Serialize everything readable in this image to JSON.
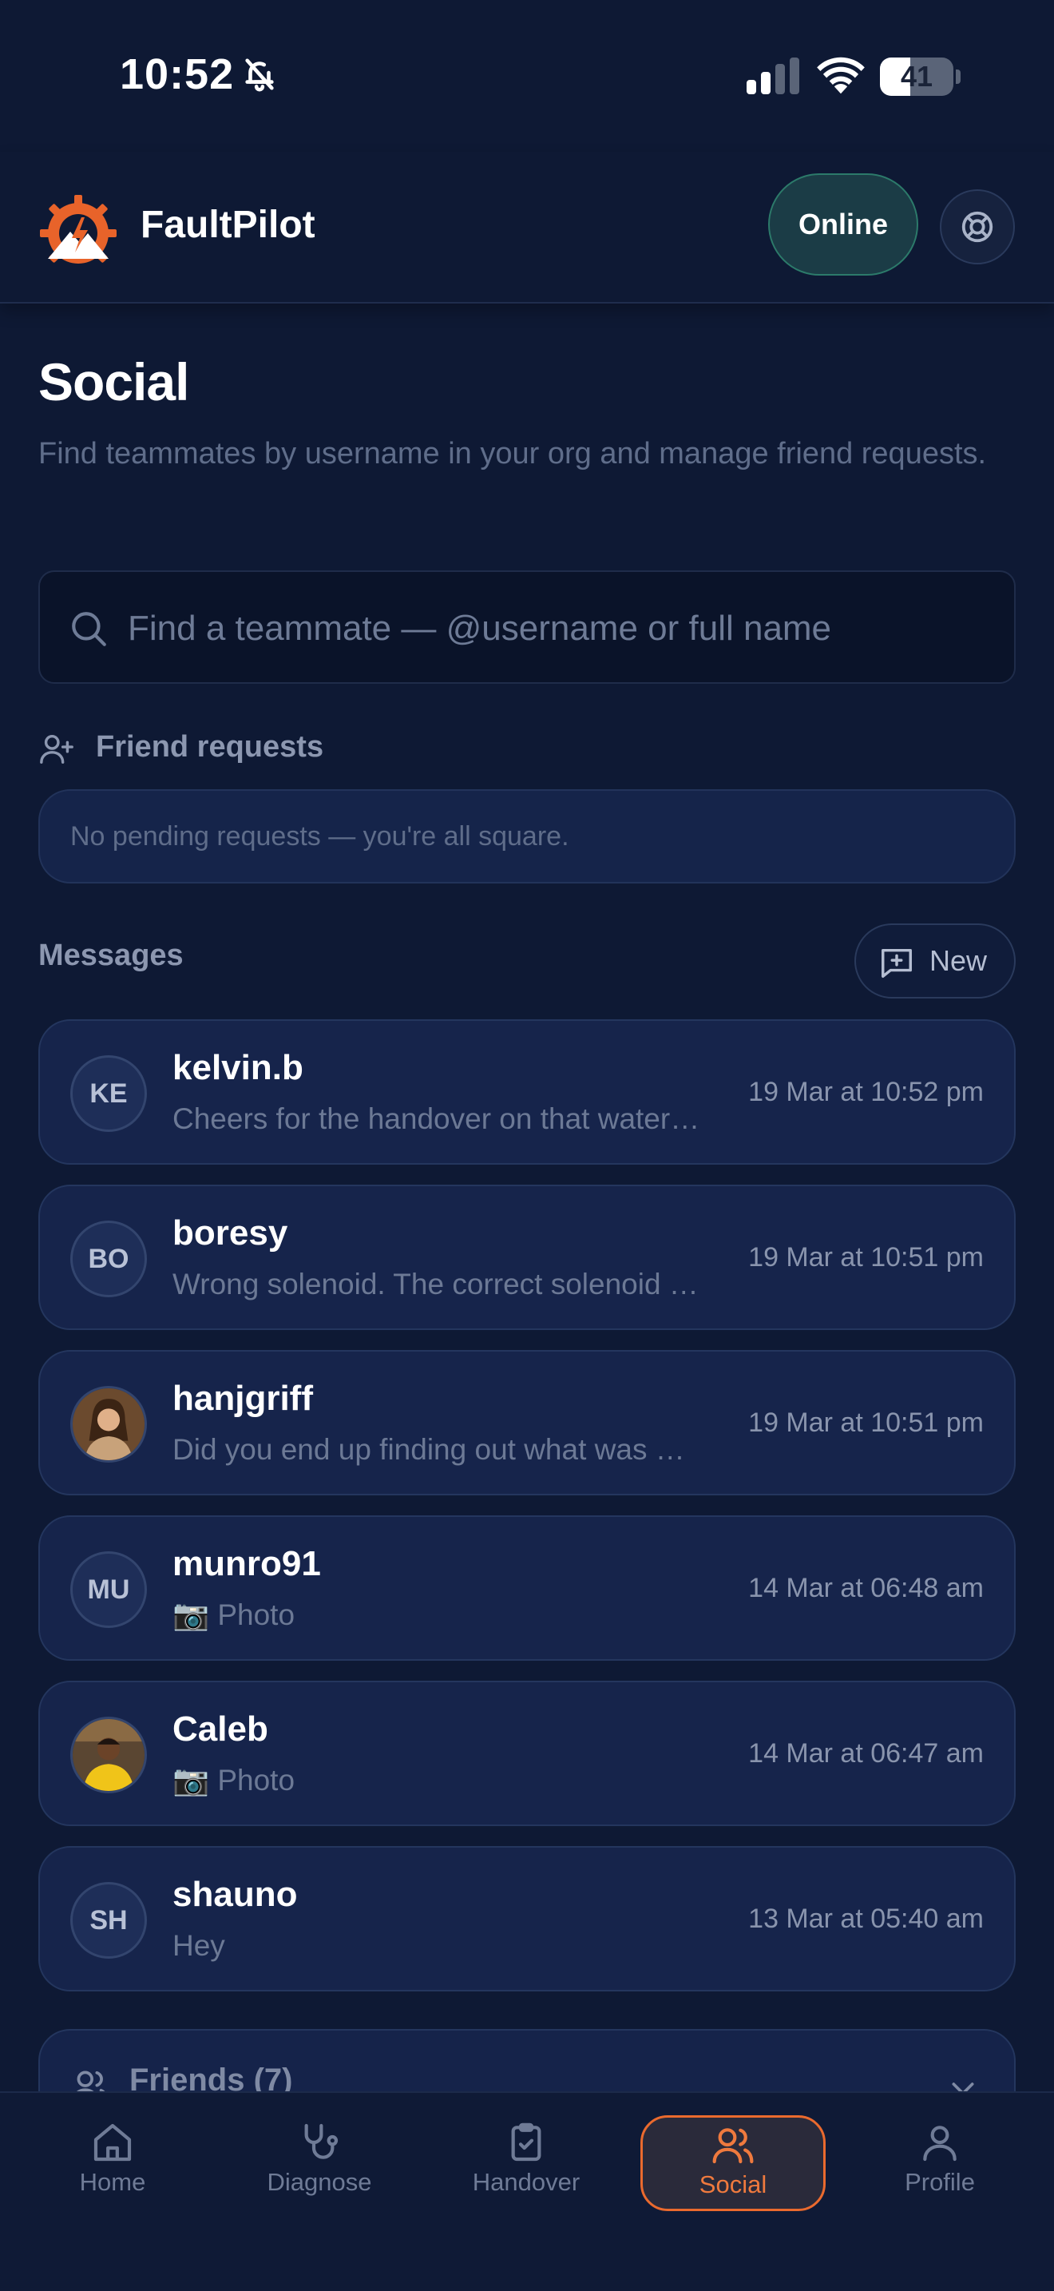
{
  "status_bar": {
    "time": "10:52",
    "battery": "41",
    "battery_level": 0.41
  },
  "header": {
    "app_name": "FaultPilot",
    "status_label": "Online"
  },
  "page": {
    "title": "Social",
    "subtitle": "Find teammates by username in your org and manage friend requests."
  },
  "search": {
    "placeholder": "Find a teammate — @username or full name"
  },
  "friend_requests": {
    "heading": "Friend requests",
    "empty_text": "No pending requests — you're all square."
  },
  "messages": {
    "heading": "Messages",
    "new_label": "New",
    "items": [
      {
        "initials": "KE",
        "name": "kelvin.b",
        "preview": "Cheers for the handover on that water…",
        "time": "19 Mar at 10:52 pm",
        "avatar": "initials"
      },
      {
        "initials": "BO",
        "name": "boresy",
        "preview": "Wrong solenoid. The correct solenoid …",
        "time": "19 Mar at 10:51 pm",
        "avatar": "initials"
      },
      {
        "initials": "",
        "name": "hanjgriff",
        "preview": "Did you end up finding out what was …",
        "time": "19 Mar at 10:51 pm",
        "avatar": "photo"
      },
      {
        "initials": "MU",
        "name": "munro91",
        "preview": "📷 Photo",
        "time": "14 Mar at 06:48 am",
        "avatar": "initials"
      },
      {
        "initials": "",
        "name": "Caleb",
        "preview": "📷 Photo",
        "time": "14 Mar at 06:47 am",
        "avatar": "photo"
      },
      {
        "initials": "SH",
        "name": "shauno",
        "preview": "Hey",
        "time": "13 Mar at 05:40 am",
        "avatar": "initials"
      }
    ]
  },
  "friends": {
    "label": "Friends (7)"
  },
  "tabs": [
    {
      "label": "Home",
      "icon": "home-icon",
      "active": false
    },
    {
      "label": "Diagnose",
      "icon": "stethoscope-icon",
      "active": false
    },
    {
      "label": "Handover",
      "icon": "clipboard-check-icon",
      "active": false
    },
    {
      "label": "Social",
      "icon": "users-icon",
      "active": true
    },
    {
      "label": "Profile",
      "icon": "user-icon",
      "active": false
    }
  ],
  "colors": {
    "background": "#0e1934",
    "accent": "#ea6a2e",
    "online": "#2c7a6a",
    "card": "#16244b"
  }
}
